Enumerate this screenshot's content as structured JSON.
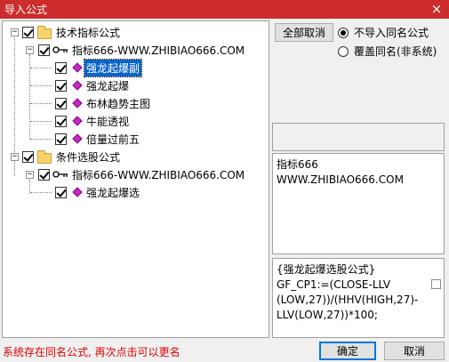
{
  "window": {
    "title": "导入公式",
    "close_glyph": "×"
  },
  "tree": {
    "root1": {
      "label": "技术指标公式"
    },
    "group1": {
      "label": "指标666-WWW.ZHIBIAO666.COM"
    },
    "items1": [
      {
        "label": "强龙起爆副"
      },
      {
        "label": "强龙起爆"
      },
      {
        "label": "布林趋势主图"
      },
      {
        "label": "牛能透视"
      },
      {
        "label": "倍量过前五"
      }
    ],
    "root2": {
      "label": "条件选股公式"
    },
    "group2": {
      "label": "指标666-WWW.ZHIBIAO666.COM"
    },
    "items2": [
      {
        "label": "强龙起爆选"
      }
    ]
  },
  "options": {
    "cancel_all_label": "全部取消",
    "radio1_label": "不导入同名公式",
    "radio2_label": "覆盖同名(非系统)"
  },
  "info": {
    "line1": "指标666",
    "line2": "WWW.ZHIBIAO666.COM"
  },
  "formula": {
    "text": "{强龙起爆选股公式}\nGF_CP1:=(CLOSE-LLV\n(LOW,27))/(HHV(HIGH,27)-\nLLV(LOW,27))*100;"
  },
  "footer": {
    "status": "系统存在同名公式, 再次点击可以更名",
    "ok_label": "确定",
    "cancel_label": "取消"
  },
  "colors": {
    "titlebar": "#cc2c2c",
    "selection": "#0a64c8",
    "status_text": "#e00000"
  }
}
